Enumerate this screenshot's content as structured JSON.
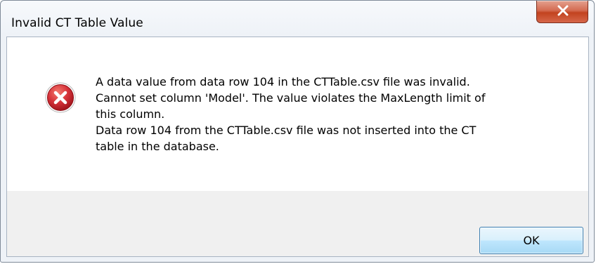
{
  "dialog": {
    "title": "Invalid CT Table Value",
    "close_icon": "close-icon",
    "error_icon": "error-icon",
    "message_lines": [
      "A data value from data row 104 in the CTTable.csv file was invalid.",
      "Cannot set column 'Model'. The value violates the MaxLength limit of",
      "this column.",
      "Data row 104 from the CTTable.csv file was not inserted into the CT",
      "table in the database."
    ],
    "ok_label": "OK"
  },
  "colors": {
    "close_button": "#c2431f",
    "error_icon": "#c8222a",
    "ok_border": "#3c7fb1"
  }
}
